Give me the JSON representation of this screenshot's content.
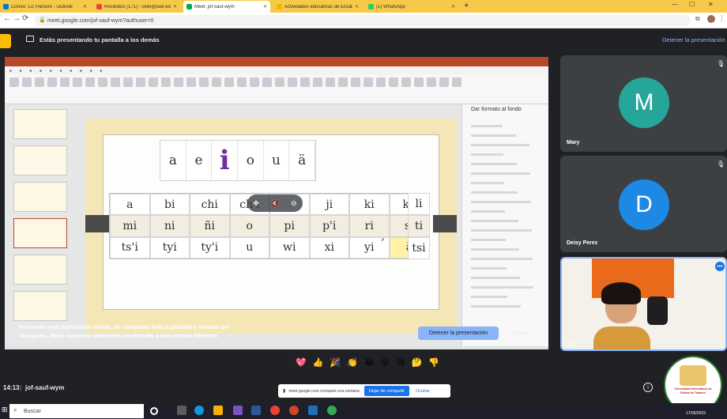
{
  "browser": {
    "tabs": [
      {
        "label": "Correo: Liz Parcero - Outlook",
        "fav": "#0078d4"
      },
      {
        "label": "Recibidos (171) - ceile@uiet.edu.mx",
        "fav": "#ea4335"
      },
      {
        "label": "Meet: jof-sauf-wym",
        "fav": "#00ac47",
        "active": true
      },
      {
        "label": "Actividades educativas de Elizabe...",
        "fav": "#f4b400"
      },
      {
        "label": "(1) WhatsApp",
        "fav": "#25d366"
      }
    ],
    "new_tab": "+",
    "url": "meet.google.com/jof-sauf-wym?authuser=0"
  },
  "banner": {
    "text": "Estás presentando tu pantalla a los demás",
    "stop_label": "Detener la presentación"
  },
  "slide": {
    "vowels": [
      "a",
      "e",
      "i",
      "o",
      "u",
      "ä"
    ],
    "big_vowel_index": 2,
    "grid": [
      [
        "a",
        "bi",
        "chi",
        "ch'i",
        "",
        "ji",
        "ki",
        "k'i"
      ],
      [
        "mi",
        "ni",
        "ñi",
        "o",
        "pi",
        "p'i",
        "ri",
        "si"
      ],
      [
        "ts'i",
        "tyi",
        "ty'i",
        "u",
        "wi",
        "xi",
        "yi",
        "ä"
      ]
    ],
    "extra_col": [
      "li",
      "ti",
      "tsi"
    ],
    "apostrophe": "’"
  },
  "format_pane": {
    "title": "Dar formato al fondo"
  },
  "warning": {
    "text": "Para evitar una duplicación infinita, no compartas toda la pantalla o ventana del navegador. Mejor comparte solamente una pestaña o una ventana diferente.",
    "stop_button": "Detener la presentación",
    "ignore_button": "Ignorar"
  },
  "participants": [
    {
      "initial": "M",
      "name": "Mary",
      "color": "#26a69a"
    },
    {
      "initial": "D",
      "name": "Deisy Perez",
      "color": "#1e88e5"
    }
  ],
  "self": {
    "name": "Tú"
  },
  "reactions": [
    "💖",
    "👍",
    "🎉",
    "👏",
    "😂",
    "😮",
    "😢",
    "🤔",
    "👎"
  ],
  "bottom": {
    "clock": "14:13",
    "separator": "|",
    "meeting_code": "jof-sauf-wym",
    "share_notice": "meet.google.com comparte una ventana",
    "stop_share": "Dejar de compartir",
    "hide": "Ocultar"
  },
  "taskbar": {
    "search_placeholder": "Buscar",
    "date": "17/05/2023"
  },
  "logo": {
    "text": "Universidad Intercultural del Estado de Tabasco"
  }
}
